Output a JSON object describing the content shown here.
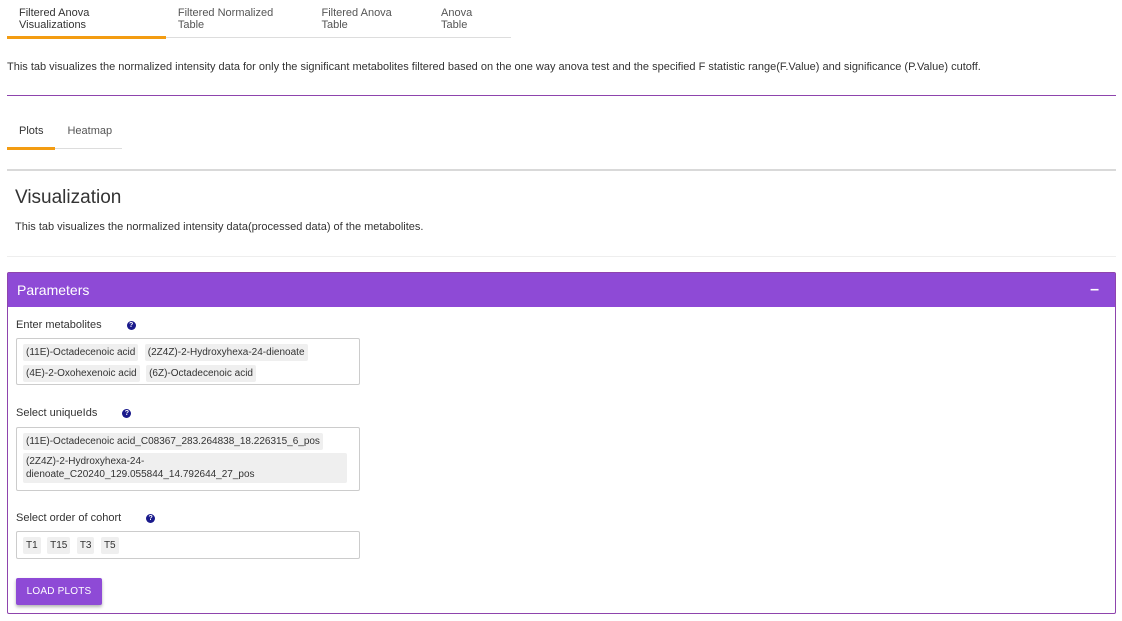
{
  "top_tabs": [
    {
      "label": "Filtered Anova Visualizations",
      "active": true
    },
    {
      "label": "Filtered Normalized Table",
      "active": false
    },
    {
      "label": "Filtered Anova Table",
      "active": false
    },
    {
      "label": "Anova Table",
      "active": false
    }
  ],
  "top_description": "This tab visualizes the normalized intensity data for only the significant metabolites filtered based on the one way anova test and the specified F statistic range(F.Value) and significance (P.Value) cutoff.",
  "sub_tabs": [
    {
      "label": "Plots",
      "active": true
    },
    {
      "label": "Heatmap",
      "active": false
    }
  ],
  "visualization": {
    "title": "Visualization",
    "description": "This tab visualizes the normalized intensity data(processed data) of the metabolites."
  },
  "parameters": {
    "title": "Parameters",
    "collapse_symbol": "–",
    "metabolites": {
      "label": "Enter metabolites",
      "selected": [
        "(11E)-Octadecenoic acid",
        "(2Z4Z)-2-Hydroxyhexa-24-dienoate",
        "(4E)-2-Oxohexenoic acid",
        "(6Z)-Octadecenoic acid"
      ]
    },
    "uniqueids": {
      "label": "Select uniqueIds",
      "selected": [
        "(11E)-Octadecenoic acid_C08367_283.264838_18.226315_6_pos",
        "(2Z4Z)-2-Hydroxyhexa-24-dienoate_C20240_129.055844_14.792644_27_pos"
      ]
    },
    "cohort": {
      "label": "Select order of cohort",
      "selected": [
        "T1",
        "T15",
        "T3",
        "T5"
      ]
    },
    "load_button": "LOAD PLOTS"
  },
  "help_symbol": "?"
}
